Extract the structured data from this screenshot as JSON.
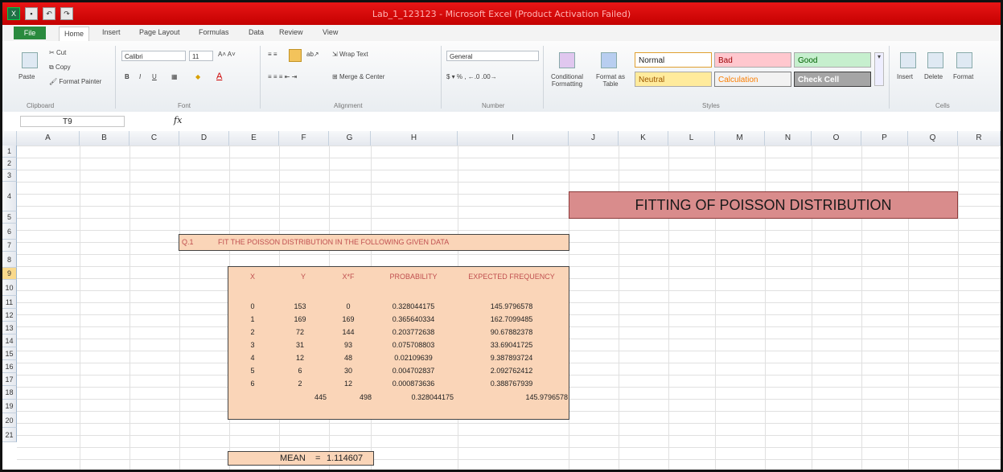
{
  "window": {
    "title": "Lab_1_123123 - Microsoft Excel (Product Activation Failed)"
  },
  "tabs": [
    "File",
    "Home",
    "Insert",
    "Page Layout",
    "Formulas",
    "Data",
    "Review",
    "View"
  ],
  "ribbon": {
    "clipboard": {
      "paste": "Paste",
      "cut": "Cut",
      "copy": "Copy",
      "format_painter": "Format Painter",
      "label": "Clipboard"
    },
    "font": {
      "name": "Calibri",
      "size": "11",
      "label": "Font"
    },
    "alignment": {
      "wrap_text": "Wrap Text",
      "merge_center": "Merge & Center",
      "label": "Alignment"
    },
    "number": {
      "format": "General",
      "label": "Number"
    },
    "styles": {
      "conditional": "Conditional Formatting",
      "format_as_table": "Format as Table",
      "normal": "Normal",
      "bad": "Bad",
      "good": "Good",
      "neutral": "Neutral",
      "calculation": "Calculation",
      "check_cell": "Check Cell",
      "label": "Styles"
    },
    "cells": {
      "insert": "Insert",
      "delete": "Delete",
      "format": "Format",
      "label": "Cells"
    }
  },
  "formula_bar": {
    "name_box": "T9",
    "fx": "fx",
    "content": ""
  },
  "columns": [
    "A",
    "B",
    "C",
    "D",
    "E",
    "F",
    "G",
    "H",
    "I",
    "J",
    "K",
    "L",
    "M",
    "N",
    "O",
    "P",
    "Q",
    "R"
  ],
  "rows": [
    "1",
    "2",
    "3",
    "4",
    "5",
    "6",
    "7",
    "8",
    "9",
    "10",
    "11",
    "12",
    "13",
    "14",
    "15",
    "16",
    "17",
    "18",
    "19",
    "20",
    "21"
  ],
  "selected_row": "9",
  "sheet": {
    "banner": "FITTING OF POISSON DISTRIBUTION",
    "question_no": "Q.1",
    "question_text": "FIT THE POISSON DISTRIBUTION IN THE FOLLOWING GIVEN DATA",
    "table": {
      "headers": [
        "X",
        "Y",
        "X*F",
        "PROBABILITY",
        "EXPECTED FREQUENCY"
      ],
      "rows": [
        [
          "0",
          "153",
          "0",
          "0.328044175",
          "145.9796578"
        ],
        [
          "1",
          "169",
          "169",
          "0.365640334",
          "162.7099485"
        ],
        [
          "2",
          "72",
          "144",
          "0.203772638",
          "90.67882378"
        ],
        [
          "3",
          "31",
          "93",
          "0.075708803",
          "33.69041725"
        ],
        [
          "4",
          "12",
          "48",
          "0.02109639",
          "9.387893724"
        ],
        [
          "5",
          "6",
          "30",
          "0.004702837",
          "2.092762412"
        ],
        [
          "6",
          "2",
          "12",
          "0.000873636",
          "0.388767939"
        ]
      ],
      "totals": [
        "445",
        "498",
        "0.328044175",
        "145.9796578"
      ]
    },
    "mean_label": "MEAN",
    "mean_eq": "=",
    "mean_value": "1.114607"
  }
}
